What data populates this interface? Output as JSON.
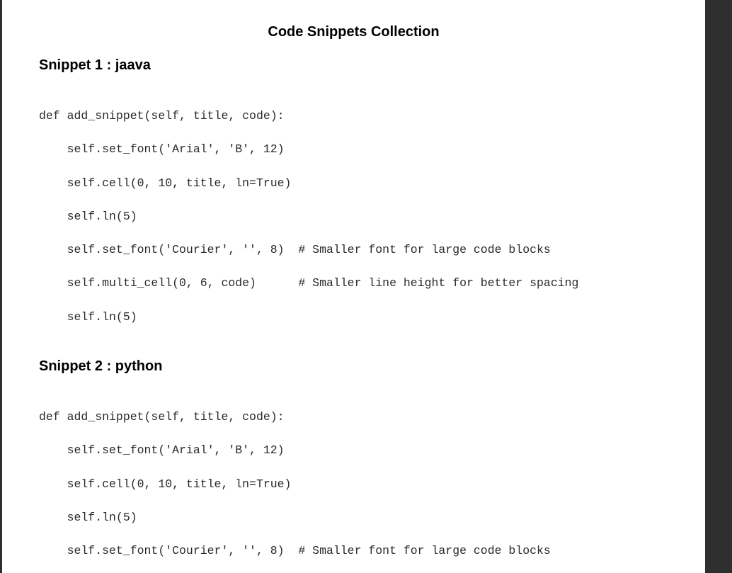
{
  "document": {
    "title": "Code Snippets Collection"
  },
  "snippets": [
    {
      "heading": "Snippet 1 : jaava",
      "lines": [
        "def add_snippet(self, title, code):",
        "    self.set_font('Arial', 'B', 12)",
        "    self.cell(0, 10, title, ln=True)",
        "    self.ln(5)",
        "    self.set_font('Courier', '', 8)  # Smaller font for large code blocks",
        "    self.multi_cell(0, 6, code)      # Smaller line height for better spacing",
        "    self.ln(5)"
      ]
    },
    {
      "heading": "Snippet 2 : python",
      "lines": [
        "def add_snippet(self, title, code):",
        "    self.set_font('Arial', 'B', 12)",
        "    self.cell(0, 10, title, ln=True)",
        "    self.ln(5)",
        "    self.set_font('Courier', '', 8)  # Smaller font for large code blocks"
      ]
    }
  ]
}
